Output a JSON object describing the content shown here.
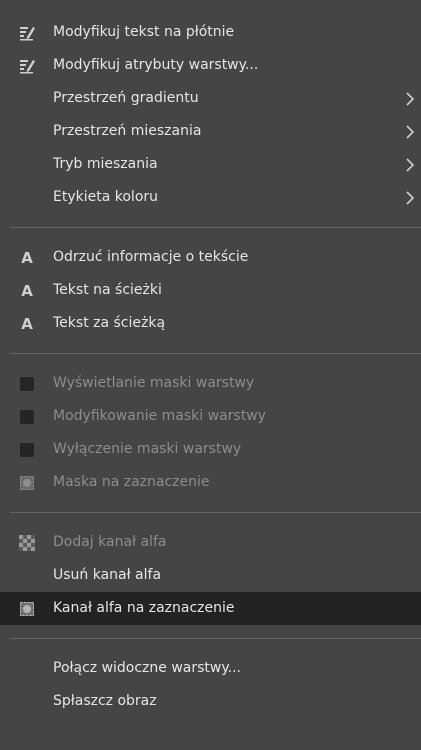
{
  "menu": {
    "items": [
      {
        "label": "Modyfikuj tekst na płótnie",
        "icon": "edit-text-icon"
      },
      {
        "label": "Modyfikuj atrybuty warstwy...",
        "icon": "edit-attributes-icon"
      },
      {
        "label": "Przestrzeń gradientu",
        "icon": "submenu-arrow"
      },
      {
        "label": "Przestrzeń mieszania",
        "icon": "submenu-arrow"
      },
      {
        "label": "Tryb mieszania",
        "icon": "submenu-arrow"
      },
      {
        "label": "Etykieta koloru",
        "icon": "submenu-arrow"
      },
      {
        "label": "Odrzuć informacje o tekście",
        "icon": "text-a-icon"
      },
      {
        "label": "Tekst na ścieżki",
        "icon": "text-a-icon"
      },
      {
        "label": "Tekst za ścieżką",
        "icon": "text-a-icon"
      },
      {
        "label": "Wyświetlanie maski warstwy",
        "icon": "mask-show-icon",
        "state": "disabled"
      },
      {
        "label": "Modyfikowanie maski warstwy",
        "icon": "mask-edit-icon",
        "state": "disabled"
      },
      {
        "label": "Wyłączenie maski warstwy",
        "icon": "mask-disable-icon",
        "state": "disabled"
      },
      {
        "label": "Maska na zaznaczenie",
        "icon": "mask-to-selection-icon",
        "state": "disabled"
      },
      {
        "label": "Dodaj kanał alfa",
        "icon": "alpha-add-icon",
        "state": "disabled"
      },
      {
        "label": "Usuń kanał alfa"
      },
      {
        "label": "Kanał alfa na zaznaczenie",
        "icon": "alpha-to-selection-icon",
        "state": "highlighted"
      },
      {
        "label": "Połącz widoczne warstwy..."
      },
      {
        "label": "Spłaszcz obraz"
      }
    ]
  },
  "colors": {
    "background": "#454545",
    "text": "#e6e6e6",
    "disabled_text": "#8d8d8d",
    "highlight": "#232323",
    "separator": "#656565"
  }
}
